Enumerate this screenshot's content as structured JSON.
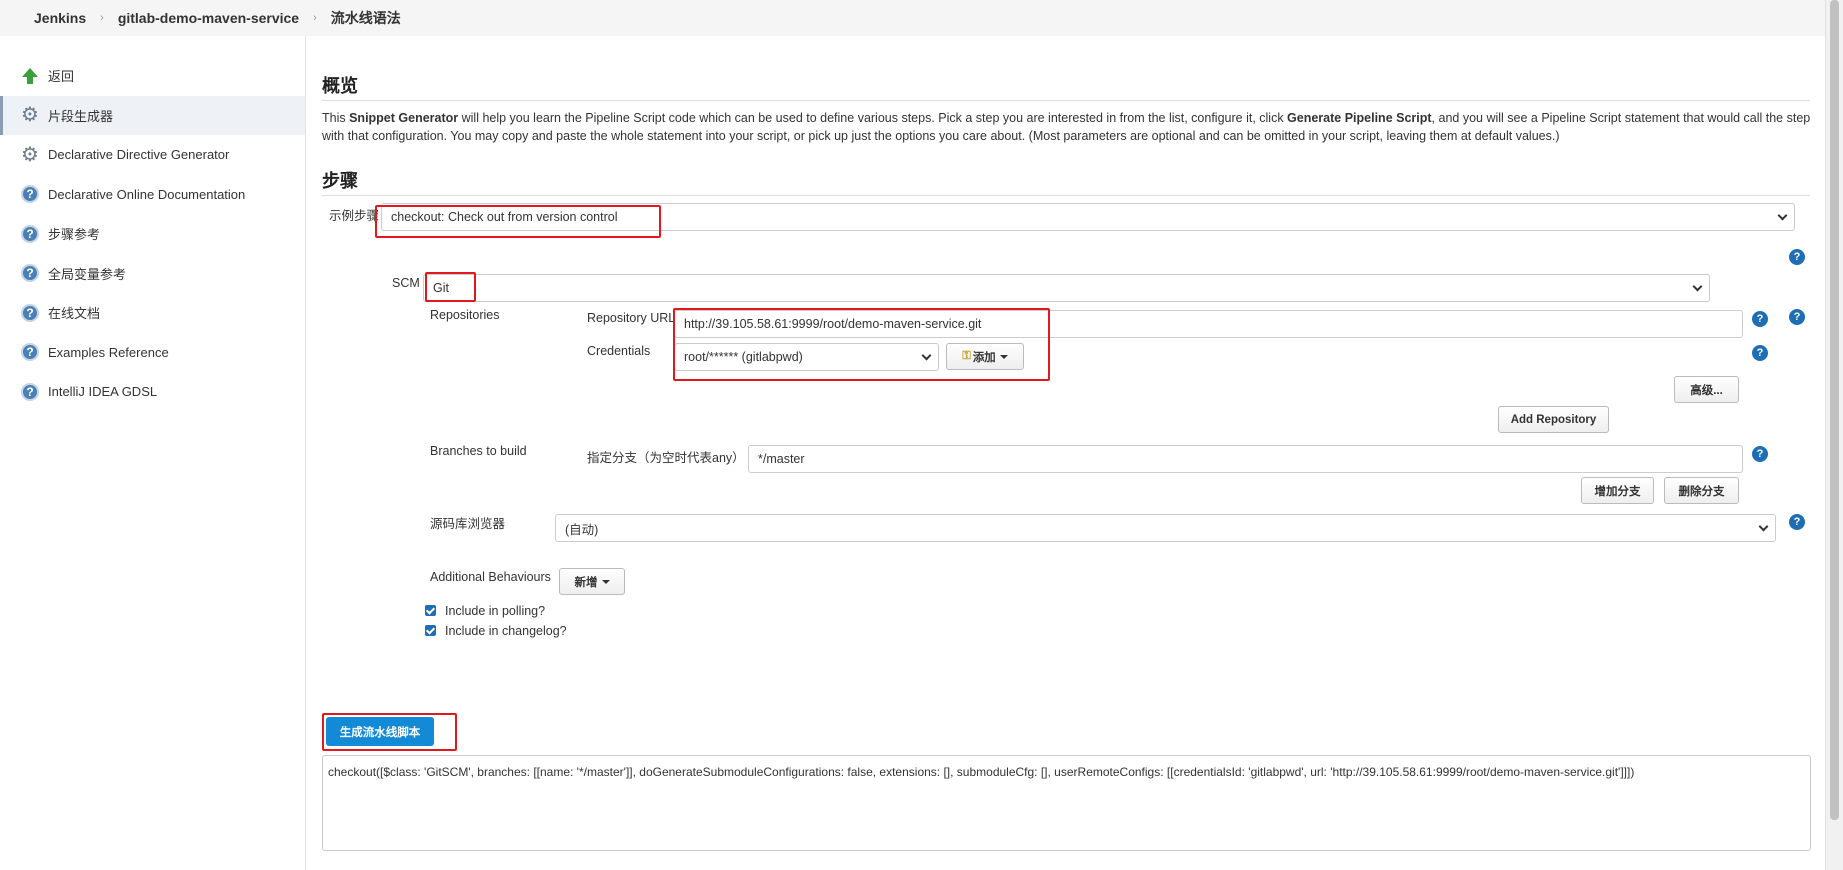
{
  "breadcrumb": {
    "items": [
      "Jenkins",
      "gitlab-demo-maven-service",
      "流水线语法"
    ]
  },
  "sidebar": {
    "items": [
      {
        "label": "返回",
        "icon": "arrow-up-icon"
      },
      {
        "label": "片段生成器",
        "icon": "gear-icon",
        "active": true
      },
      {
        "label": "Declarative Directive Generator",
        "icon": "gear-icon"
      },
      {
        "label": "Declarative Online Documentation",
        "icon": "help-icon"
      },
      {
        "label": "步骤参考",
        "icon": "help-icon"
      },
      {
        "label": "全局变量参考",
        "icon": "help-icon"
      },
      {
        "label": "在线文档",
        "icon": "help-icon"
      },
      {
        "label": "Examples Reference",
        "icon": "help-icon"
      },
      {
        "label": "IntelliJ IDEA GDSL",
        "icon": "help-icon"
      }
    ]
  },
  "overview": {
    "title": "概览",
    "desc_parts": {
      "p1": "This ",
      "b1": "Snippet Generator",
      "p2": " will help you learn the Pipeline Script code which can be used to define various steps. Pick a step you are interested in from the list, configure it, click ",
      "b2": "Generate Pipeline Script",
      "p3": ", and you will see a Pipeline Script statement that would call the step with that configuration. You may copy and paste the whole statement into your script, or pick up just the options you care about. (Most parameters are optional and can be omitted in your script, leaving them at default values.)"
    }
  },
  "steps": {
    "title": "步骤",
    "sample_step_label": "示例步骤",
    "sample_step_value": "checkout: Check out from version control",
    "scm_label": "SCM",
    "scm_value": "Git",
    "repositories_label": "Repositories",
    "repo_url_label": "Repository URL",
    "repo_url_value": "http://39.105.58.61:9999/root/demo-maven-service.git",
    "credentials_label": "Credentials",
    "credentials_value": "root/****** (gitlabpwd)",
    "add_button": "添加",
    "advanced_button": "高级...",
    "add_repository_button": "Add Repository",
    "branches_label": "Branches to build",
    "branch_specifier_label": "指定分支（为空时代表any）",
    "branch_value": "*/master",
    "add_branch_button": "增加分支",
    "delete_branch_button": "删除分支",
    "repo_browser_label": "源码库浏览器",
    "repo_browser_value": "(自动)",
    "additional_behaviours_label": "Additional Behaviours",
    "new_button": "新增",
    "include_polling_label": "Include in polling?",
    "include_changelog_label": "Include in changelog?",
    "include_polling_checked": true,
    "include_changelog_checked": true
  },
  "generate": {
    "button": "生成流水线脚本",
    "output": "checkout([$class: 'GitSCM', branches: [[name: '*/master']], doGenerateSubmoduleConfigurations: false, extensions: [], submoduleCfg: [], userRemoteConfigs: [[credentialsId: 'gitlabpwd', url: 'http://39.105.58.61:9999/root/demo-maven-service.git']]])"
  },
  "colors": {
    "primary": "#138ad6",
    "highlight": "#e0191f",
    "help_icon": "#1e6eb5"
  }
}
